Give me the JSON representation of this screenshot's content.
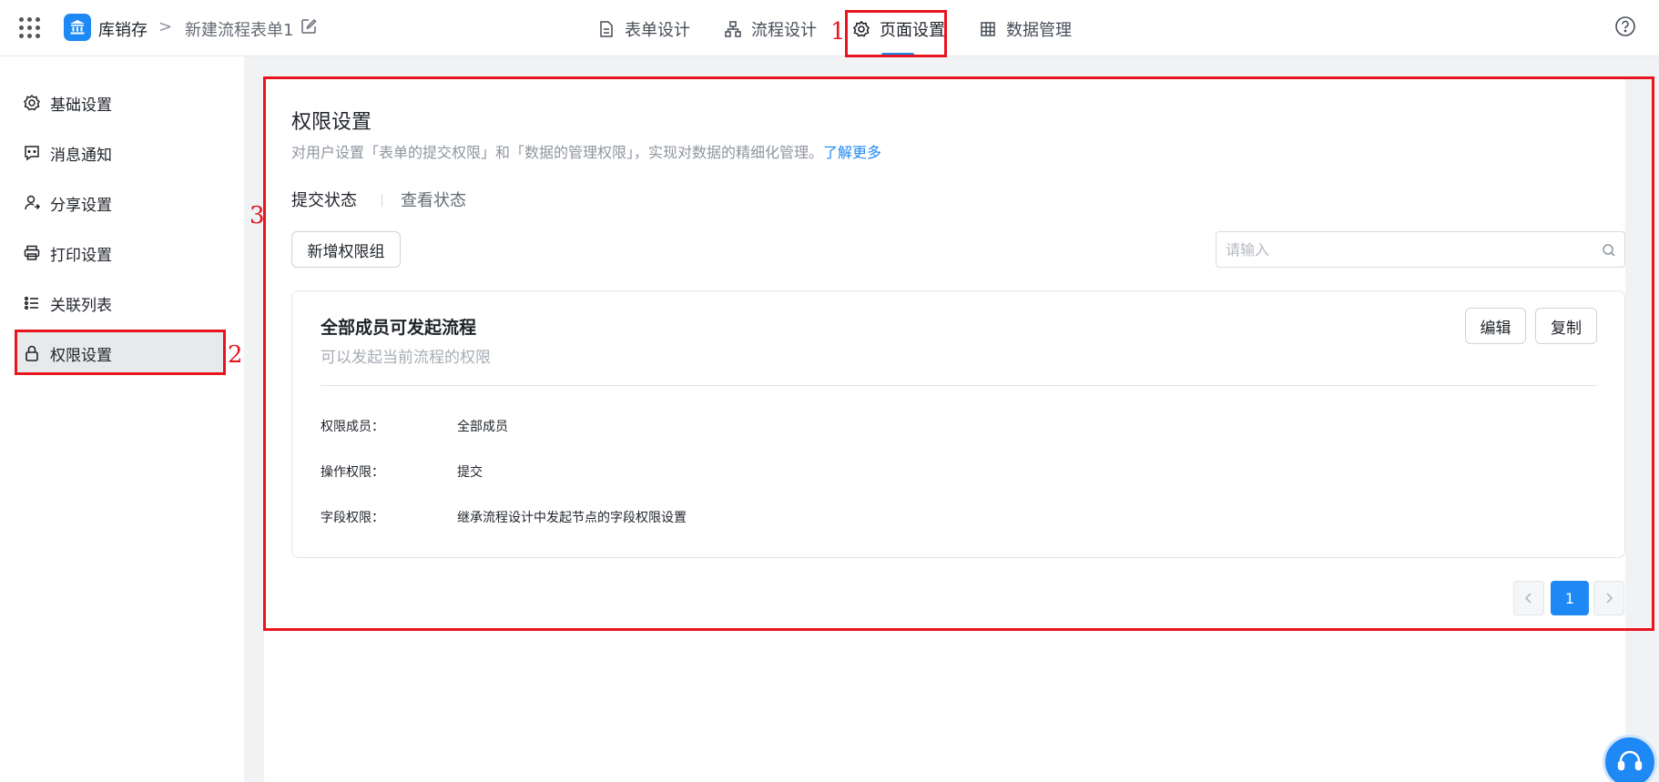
{
  "header": {
    "app_name": "库销存",
    "breadcrumb_sep": ">",
    "form_name": "新建流程表单1",
    "tabs": [
      {
        "label": "表单设计",
        "icon": "document-icon"
      },
      {
        "label": "流程设计",
        "icon": "flow-icon"
      },
      {
        "label": "页面设置",
        "icon": "gear-icon",
        "active": true
      },
      {
        "label": "数据管理",
        "icon": "grid-icon"
      }
    ],
    "help_icon": "help-icon"
  },
  "sidebar": {
    "items": [
      {
        "label": "基础设置",
        "icon": "gear-icon"
      },
      {
        "label": "消息通知",
        "icon": "message-icon"
      },
      {
        "label": "分享设置",
        "icon": "share-user-icon"
      },
      {
        "label": "打印设置",
        "icon": "printer-icon"
      },
      {
        "label": "关联列表",
        "icon": "list-icon"
      },
      {
        "label": "权限设置",
        "icon": "lock-icon",
        "active": true
      }
    ]
  },
  "main": {
    "title": "权限设置",
    "description": "对用户设置「表单的提交权限」和「数据的管理权限」，实现对数据的精细化管理。",
    "learn_more": "了解更多",
    "sub_tabs": [
      "提交状态",
      "查看状态"
    ],
    "add_group_button": "新增权限组",
    "search_placeholder": "请输入",
    "card": {
      "title": "全部成员可发起流程",
      "subtitle": "可以发起当前流程的权限",
      "edit_button": "编辑",
      "copy_button": "复制",
      "rows": [
        {
          "label": "权限成员：",
          "value": "全部成员"
        },
        {
          "label": "操作权限：",
          "value": "提交"
        },
        {
          "label": "字段权限：",
          "value": "继承流程设计中发起节点的字段权限设置"
        }
      ]
    },
    "pagination": {
      "current": "1"
    }
  },
  "annotations": [
    "1",
    "2",
    "3"
  ],
  "colors": {
    "accent": "#1e88f5",
    "annotation": "#e8141f"
  }
}
